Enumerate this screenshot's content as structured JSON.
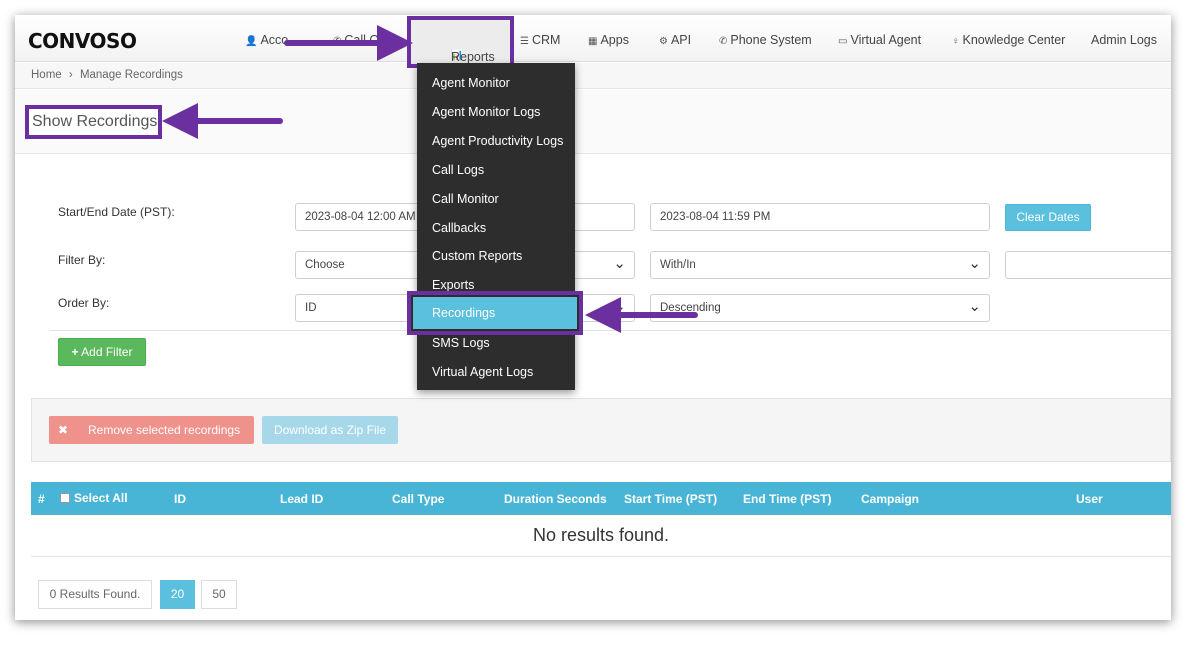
{
  "nav": {
    "logo": "CONVOSO",
    "items": [
      {
        "label": "Acco",
        "icon": "user-icon"
      },
      {
        "label": "Call C",
        "icon": "phone-icon"
      },
      {
        "label": "Reports",
        "icon": "bar-chart-icon"
      },
      {
        "label": "CRM",
        "icon": "list-icon"
      },
      {
        "label": "Apps",
        "icon": "grid-icon"
      },
      {
        "label": "API",
        "icon": "gear-icon"
      },
      {
        "label": "Phone System",
        "icon": "phone-icon"
      },
      {
        "label": "Virtual Agent",
        "icon": "monitor-icon"
      },
      {
        "label": "Knowledge Center",
        "icon": "lightbulb-icon"
      },
      {
        "label": "Admin Logs",
        "icon": ""
      }
    ]
  },
  "breadcrumb": {
    "home": "Home",
    "separator": "›",
    "current": "Manage Recordings"
  },
  "page": {
    "title": "Show Recordings"
  },
  "form": {
    "date_label": "Start/End Date (PST):",
    "start_date": "2023-08-04 12:00 AM",
    "end_date": "2023-08-04 11:59 PM",
    "clear_dates": "Clear Dates",
    "filter_label": "Filter By:",
    "filter_choose": "Choose",
    "filter_operator": "With/In",
    "order_label": "Order By:",
    "order_field": "ID",
    "order_direction": "Descending",
    "add_filter": "Add Filter"
  },
  "actions": {
    "remove": "Remove selected recordings",
    "download": "Download as Zip File"
  },
  "table": {
    "columns": [
      "#",
      "Select All",
      "ID",
      "Lead ID",
      "Call Type",
      "Duration Seconds",
      "Start Time (PST)",
      "End Time (PST)",
      "Campaign",
      "User"
    ],
    "empty": "No results found."
  },
  "pagination": {
    "results": "0 Results Found.",
    "sizes": [
      "20",
      "50"
    ],
    "active": "20"
  },
  "reports_menu": {
    "items": [
      "Agent Monitor",
      "Agent Monitor Logs",
      "Agent Productivity Logs",
      "Call Logs",
      "Call Monitor",
      "Callbacks",
      "Custom Reports",
      "Exports",
      "Recordings",
      "SMS Logs",
      "Virtual Agent Logs"
    ],
    "highlighted": "Recordings"
  },
  "colors": {
    "annotation": "#6b2fa0",
    "info": "#5bc0de",
    "success": "#5cb85c",
    "danger": "#ef928c"
  }
}
